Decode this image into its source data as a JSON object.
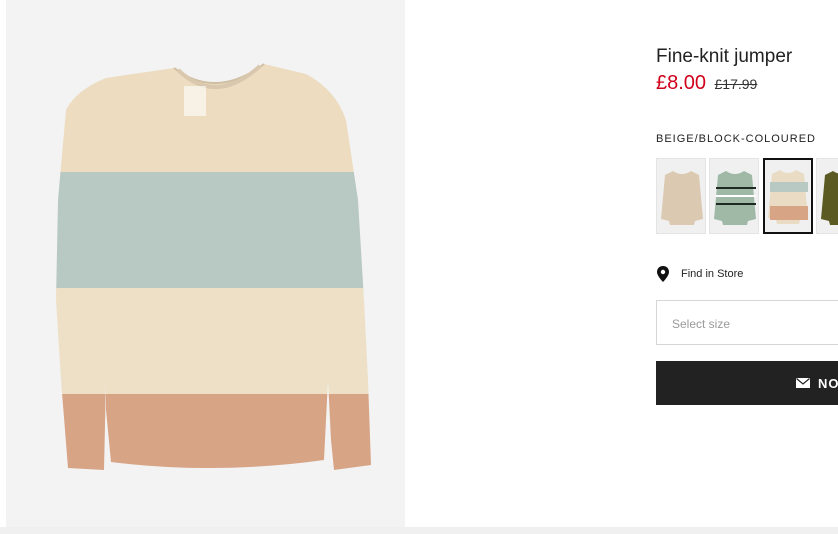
{
  "product": {
    "title": "Fine-knit jumper",
    "price_current": "£8.00",
    "price_original": "£17.99",
    "image_alt": "product-image",
    "colours": {
      "selected_label": "BEIGE/BLOCK-COLOURED",
      "swatches": [
        {
          "name": "beige"
        },
        {
          "name": "green-striped"
        },
        {
          "name": "beige-block-coloured",
          "selected": true
        },
        {
          "name": "khaki-green"
        }
      ]
    }
  },
  "store": {
    "find_label": "Find in Store",
    "icon": "location-pin-icon"
  },
  "size": {
    "placeholder": "Select size"
  },
  "notify": {
    "label": "NO",
    "icon": "envelope-icon"
  },
  "colors": {
    "price_red": "#d0021b",
    "button_bg": "#222222"
  }
}
